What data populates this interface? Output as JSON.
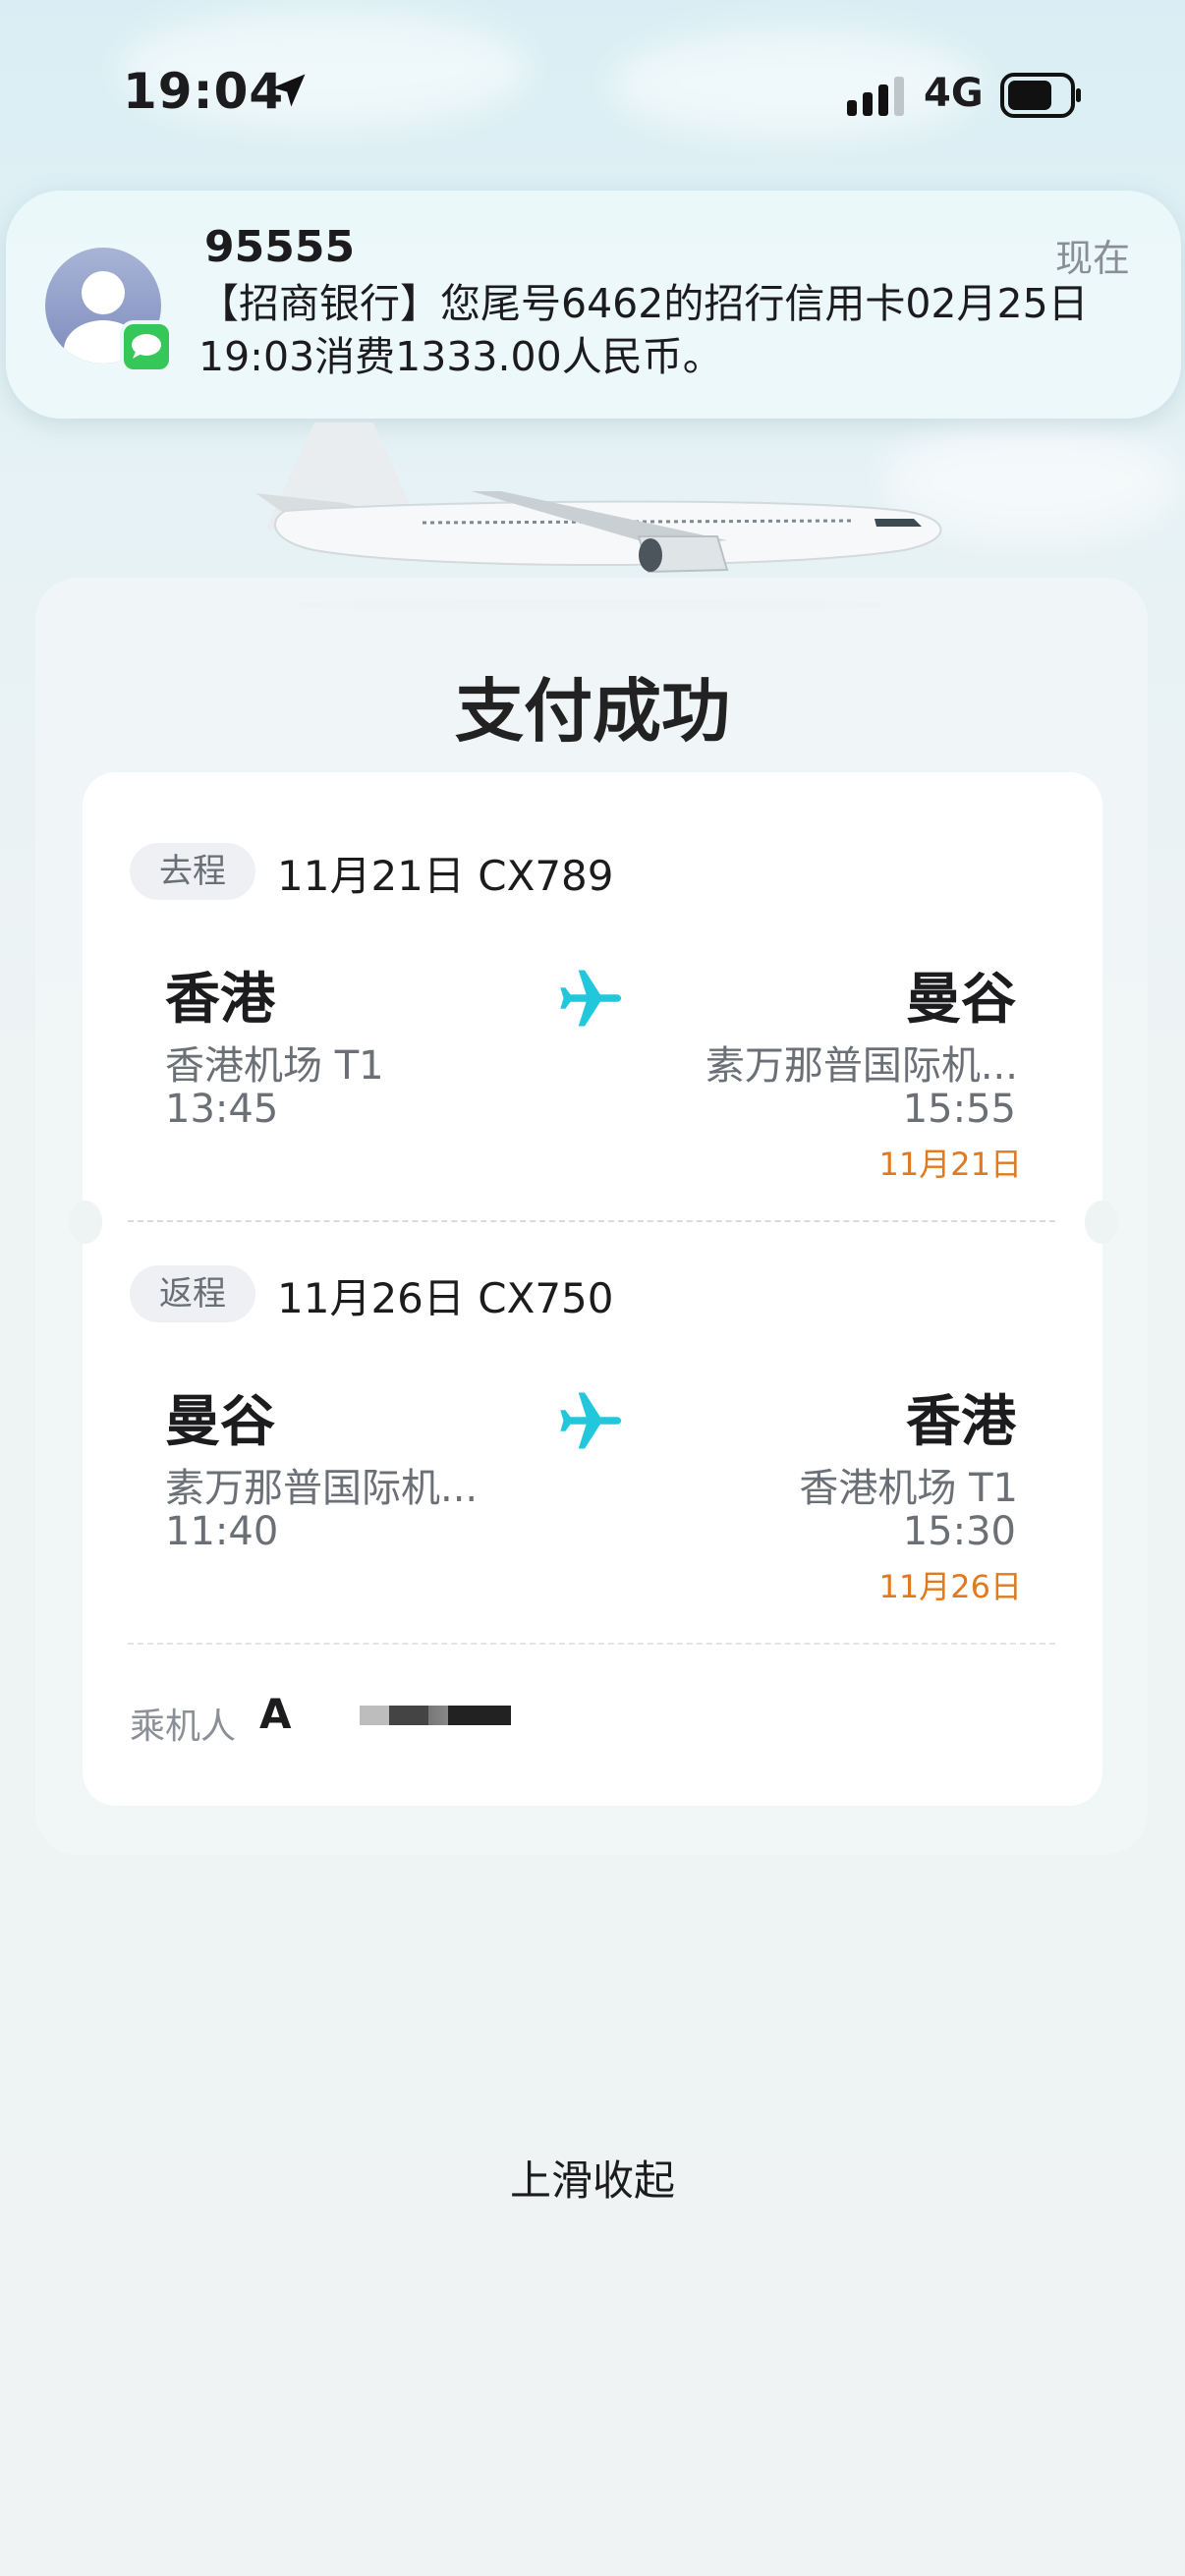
{
  "status_bar": {
    "time": "19:04",
    "network": "4G"
  },
  "notification": {
    "sender": "95555",
    "time": "现在",
    "body": "【招商银行】您尾号6462的招行信用卡02月25日19:03消费1333.00人民币。"
  },
  "page": {
    "title": "支付成功",
    "swipe_hint": "上滑收起"
  },
  "outbound": {
    "tag": "去程",
    "date_flight": "11月21日 CX789",
    "from_city": "香港",
    "from_airport": "香港机场 T1",
    "depart_time": "13:45",
    "to_city": "曼谷",
    "to_airport": "素万那普国际机...",
    "arrive_time": "15:55",
    "arrive_date": "11月21日"
  },
  "return": {
    "tag": "返程",
    "date_flight": "11月26日 CX750",
    "from_city": "曼谷",
    "from_airport": "素万那普国际机...",
    "depart_time": "11:40",
    "to_city": "香港",
    "to_airport": "香港机场 T1",
    "arrive_time": "15:30",
    "arrive_date": "11月26日"
  },
  "passenger": {
    "label": "乘机人",
    "name": "A"
  },
  "colors": {
    "accent_plane": "#22c7dc",
    "arrive_date": "#e07a1f",
    "imessage_green": "#36c759"
  }
}
